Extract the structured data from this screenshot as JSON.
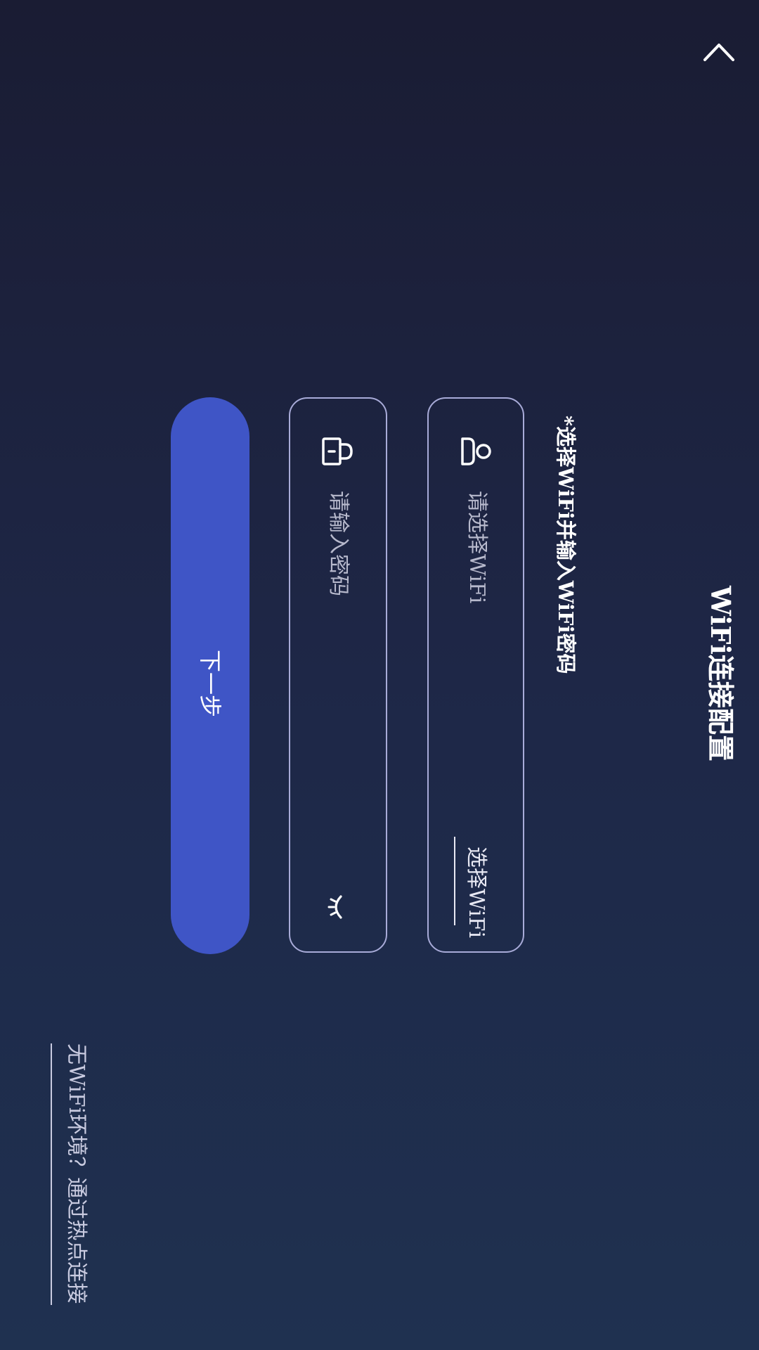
{
  "header": {
    "title": "WiFi连接配置",
    "collapse_icon": "chevron-up-icon"
  },
  "form": {
    "hint": "*选择WiFi并输入WiFi密码",
    "wifi_field": {
      "icon": "user-icon",
      "placeholder": "请选择WiFi",
      "action_label": "选择WiFi"
    },
    "password_field": {
      "icon": "lock-icon",
      "placeholder": "请输入密码",
      "toggle_icon": "eye-closed-icon"
    },
    "next_label": "下一步"
  },
  "footer": {
    "hotspot_link": "无WiFi环境？通过热点连接"
  },
  "colors": {
    "accent": "#3f55c6",
    "border": "#a8abd8",
    "background_top": "#1a1c33",
    "background_bottom": "#1f3150"
  }
}
